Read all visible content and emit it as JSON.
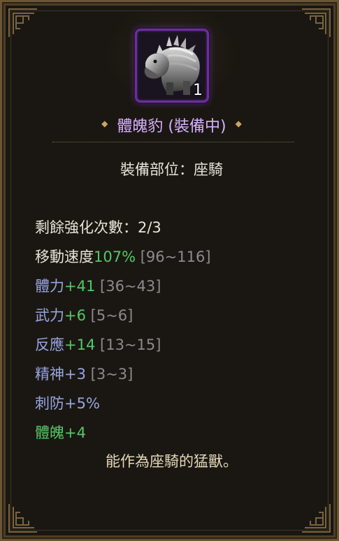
{
  "item": {
    "count": "1",
    "diamond": "◆",
    "name": "體魄豹 (裝備中)",
    "slot": "裝備部位：座騎"
  },
  "stats": {
    "enhance": {
      "label": "剩餘強化次數：",
      "value": "2/3"
    },
    "speed": {
      "label": "移動速度",
      "value": "107%",
      "range": "[96~116]"
    },
    "stamina": {
      "label": "體力",
      "value": "+41",
      "range": "[36~43]"
    },
    "force": {
      "label": "武力",
      "value": "+6",
      "range": "[5~6]"
    },
    "reflex": {
      "label": "反應",
      "value": "+14",
      "range": "[13~15]"
    },
    "spirit": {
      "label": "精神",
      "value": "+3",
      "range": "[3~3]"
    },
    "pierce_def": {
      "label": "刺防",
      "value": "+5%"
    },
    "physique": {
      "label": "體魄",
      "value": "+4"
    }
  },
  "description": "能作為座騎的猛獸。",
  "colors": {
    "frame_border": "#6b5634",
    "panel_bg": "#1a1712",
    "item_name": "#d7b0ff",
    "item_frame": "#6b2fa0",
    "stat_blue": "#98a4e2",
    "stat_green": "#55c865",
    "range_gray": "#8b8b8b",
    "description": "#e3d8b8"
  },
  "icons": [
    "beast-mount-icon",
    "diamond-bullet-icon",
    "ornate-corner-icon"
  ]
}
